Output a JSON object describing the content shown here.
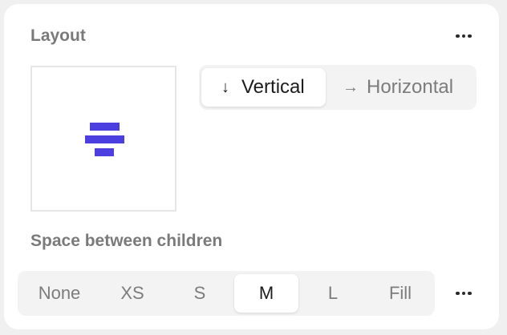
{
  "layout": {
    "title": "Layout",
    "preview_icon": "stack-vertical-icon",
    "direction": {
      "selected": "Vertical",
      "options": [
        {
          "label": "Vertical",
          "icon": "arrow-down-icon",
          "glyph": "↓"
        },
        {
          "label": "Horizontal",
          "icon": "arrow-right-icon",
          "glyph": "→"
        }
      ]
    }
  },
  "spacing": {
    "title": "Space between children",
    "selected": "M",
    "options": [
      "None",
      "XS",
      "S",
      "M",
      "L",
      "Fill"
    ]
  },
  "colors": {
    "accent": "#4b3fe0",
    "panel_bg": "#ffffff",
    "page_bg": "#f0f0f0",
    "segment_bg": "#f3f3f3"
  }
}
